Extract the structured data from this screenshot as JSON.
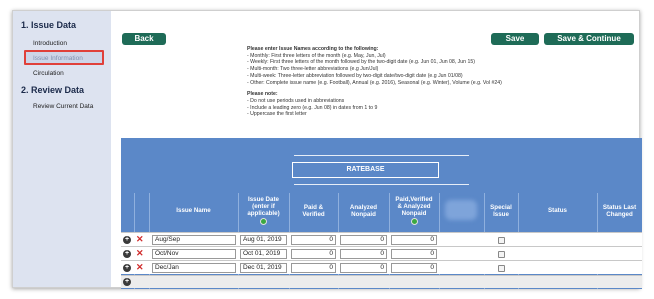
{
  "sidebar": {
    "sections": [
      {
        "title": "1. Issue Data",
        "items": [
          "Introduction",
          "Issue Information",
          "Circulation"
        ]
      },
      {
        "title": "2. Review Data",
        "items": [
          "Review Current Data"
        ]
      }
    ]
  },
  "toolbar": {
    "back_label": "Back",
    "save_label": "Save",
    "save_continue_label": "Save & Continue"
  },
  "instructions": {
    "heading": "Please enter Issue Names according to the following:",
    "lines": [
      "- Monthly: First three letters of the month (e.g. May, Jun, Jul)",
      "- Weekly: First three letters of the month followed by the two-digit date (e.g. Jun 01, Jun 08, Jun 15)",
      "- Multi-month: Two three-letter abbreviations (e.g Jun/Jul)",
      "- Multi-week: Three-letter abbreviation followed by two-digit date/two-digit date (e.g Jun 01/08)",
      "- Other: Complete issue name (e.g. Football), Annual (e.g. 2016), Seasonal (e.g. Winter), Volume (e.g. Vol #24)"
    ],
    "note_heading": "Please note:",
    "notes": [
      "- Do not use periods used in abbreviations",
      "- Include a leading zero (e.g. Jun 08) in dates from 1 to 9",
      "- Uppercase the first letter"
    ]
  },
  "table": {
    "banner": "RATEBASE",
    "headers": {
      "issue_name": "Issue Name",
      "issue_date_l1": "Issue Date",
      "issue_date_l2": "(enter if",
      "issue_date_l3": "applicable)",
      "paid_verified_l1": "Paid &",
      "paid_verified_l2": "Verified",
      "analyzed_nonpaid_l1": "Analyzed",
      "analyzed_nonpaid_l2": "Nonpaid",
      "pvan_l1": "Paid,Verified",
      "pvan_l2": "& Analyzed",
      "pvan_l3": "Nonpaid",
      "special_l1": "Special",
      "special_l2": "Issue",
      "status": "Status",
      "status_last_l1": "Status Last",
      "status_last_l2": "Changed"
    },
    "rows": [
      {
        "issue_name": "Aug/Sep",
        "issue_date": "Aug 01, 2019",
        "paid_verified": "0",
        "analyzed_nonpaid": "0",
        "pvan": "0"
      },
      {
        "issue_name": "Oct/Nov",
        "issue_date": "Oct 01, 2019",
        "paid_verified": "0",
        "analyzed_nonpaid": "0",
        "pvan": "0"
      },
      {
        "issue_name": "Dec/Jan",
        "issue_date": "Dec 01, 2019",
        "paid_verified": "0",
        "analyzed_nonpaid": "0",
        "pvan": "0"
      }
    ]
  },
  "icons": {
    "add": "plus-circle-icon",
    "delete": "red-x-icon",
    "info": "green-info-icon"
  },
  "colors": {
    "button": "#1e6b57",
    "panel": "#5b88c8",
    "sidebar": "#dde3f0",
    "highlight_border": "#e0403a"
  }
}
